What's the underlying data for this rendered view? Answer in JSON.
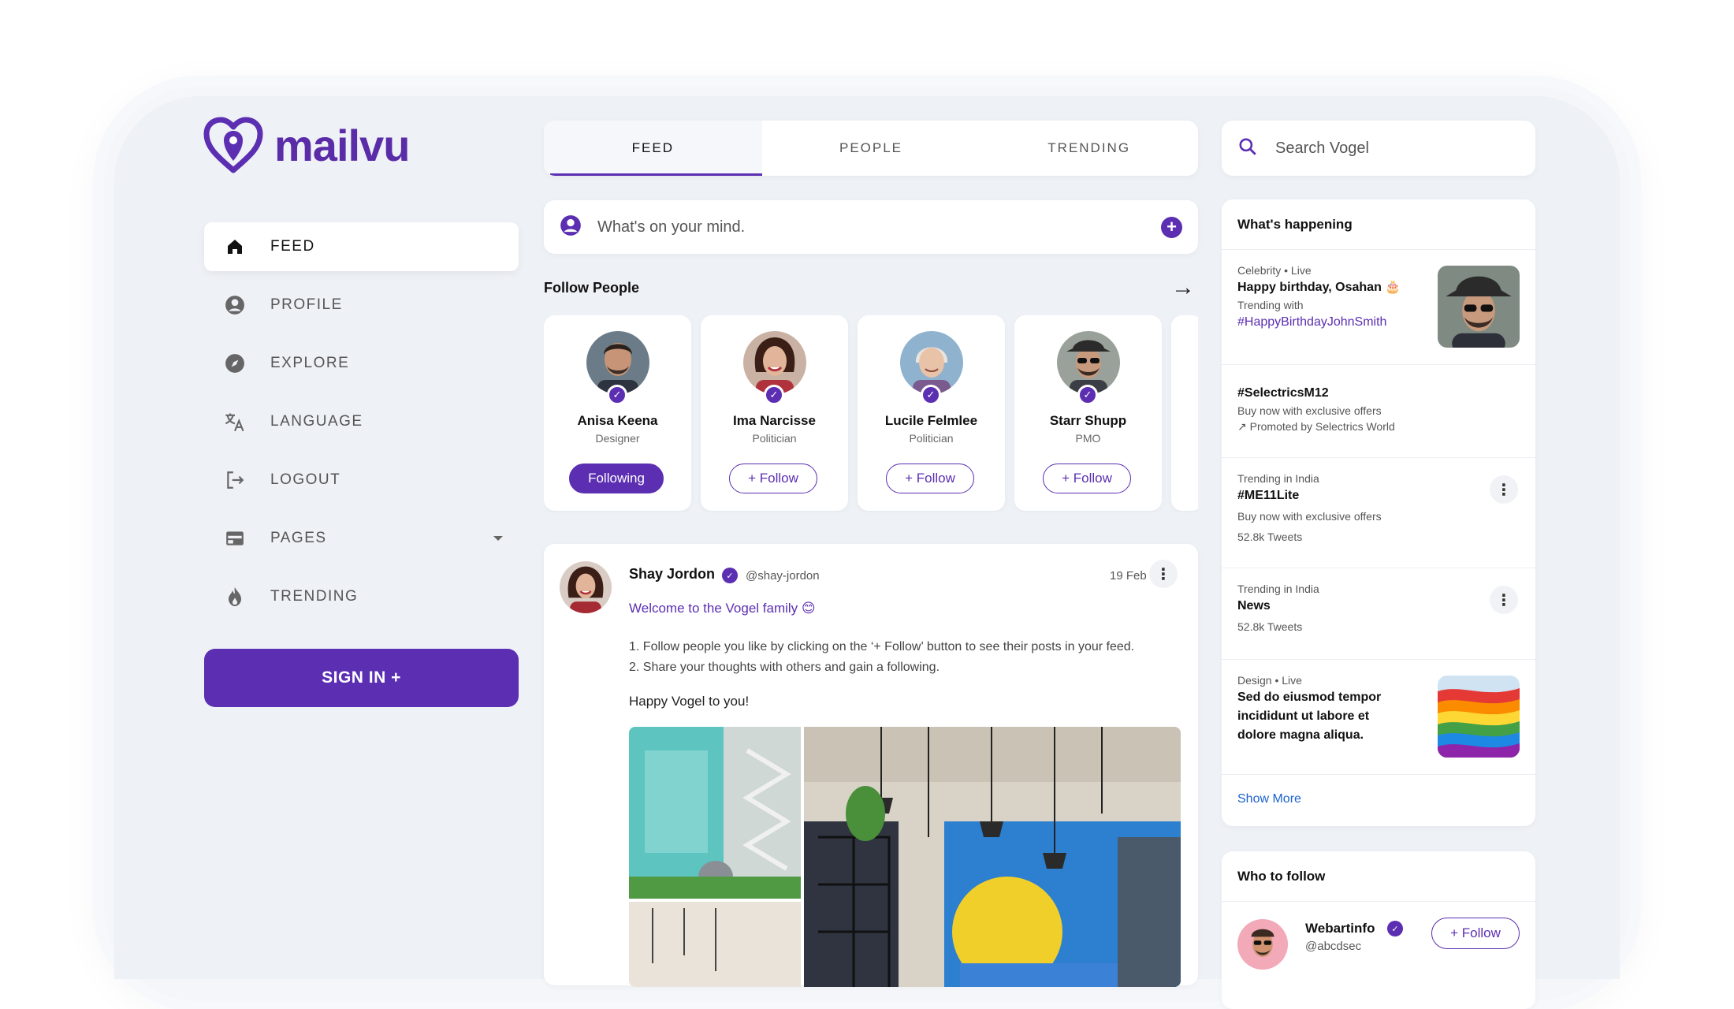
{
  "brand": {
    "name": "mailvu",
    "color": "#5b2eb2"
  },
  "nav": {
    "items": [
      {
        "label": "FEED",
        "icon": "home-icon",
        "active": true
      },
      {
        "label": "PROFILE",
        "icon": "account-circle-icon"
      },
      {
        "label": "EXPLORE",
        "icon": "compass-icon"
      },
      {
        "label": "LANGUAGE",
        "icon": "translate-icon"
      },
      {
        "label": "LOGOUT",
        "icon": "logout-icon"
      },
      {
        "label": "PAGES",
        "icon": "web-page-icon",
        "dropdown": true
      },
      {
        "label": "TRENDING",
        "icon": "fire-icon"
      }
    ],
    "signin_label": "SIGN IN +"
  },
  "tabs": [
    "FEED",
    "PEOPLE",
    "TRENDING"
  ],
  "composer": {
    "placeholder": "What's on your mind."
  },
  "follow_people": {
    "title": "Follow People",
    "people": [
      {
        "name": "Anisa Keena",
        "role": "Designer",
        "button": "Following",
        "following": true
      },
      {
        "name": "Ima Narcisse",
        "role": "Politician",
        "button": "+ Follow"
      },
      {
        "name": "Lucile Felmlee",
        "role": "Politician",
        "button": "+ Follow"
      },
      {
        "name": "Starr Shupp",
        "role": "PMO",
        "button": "+ Follow"
      }
    ]
  },
  "post": {
    "author": "Shay Jordon",
    "handle": "@shay-jordon",
    "date": "19 Feb",
    "welcome": "Welcome to the Vogel family 😊",
    "line1": "1. Follow people you like by clicking on the ‘+ Follow’ button to see their posts in your feed.",
    "line2": "2. Share your thoughts with others and gain a following.",
    "closing": "Happy Vogel to you!"
  },
  "search": {
    "placeholder": "Search Vogel"
  },
  "happening": {
    "title": "What's happening",
    "items": [
      {
        "meta": "Celebrity • Live",
        "title": "Happy birthday, Osahan 🎂",
        "sub": "Trending with",
        "link": "#HappyBirthdayJohnSmith"
      },
      {
        "title": "#SelectricsM12",
        "sub": "Buy now with exclusive offers",
        "promo": "Promoted by Selectrics World"
      },
      {
        "meta": "Trending in India",
        "title": "#ME11Lite",
        "sub": "Buy now with exclusive offers",
        "count": "52.8k Tweets"
      },
      {
        "meta": "Trending in India",
        "title": "News",
        "count": "52.8k Tweets"
      },
      {
        "meta": "Design • Live",
        "title": "Sed do eiusmod tempor incididunt ut labore et dolore magna aliqua."
      }
    ],
    "show_more": "Show More"
  },
  "who_to_follow": {
    "title": "Who to follow",
    "name": "Webartinfo",
    "handle": "@abcdsec",
    "button": "+ Follow"
  }
}
